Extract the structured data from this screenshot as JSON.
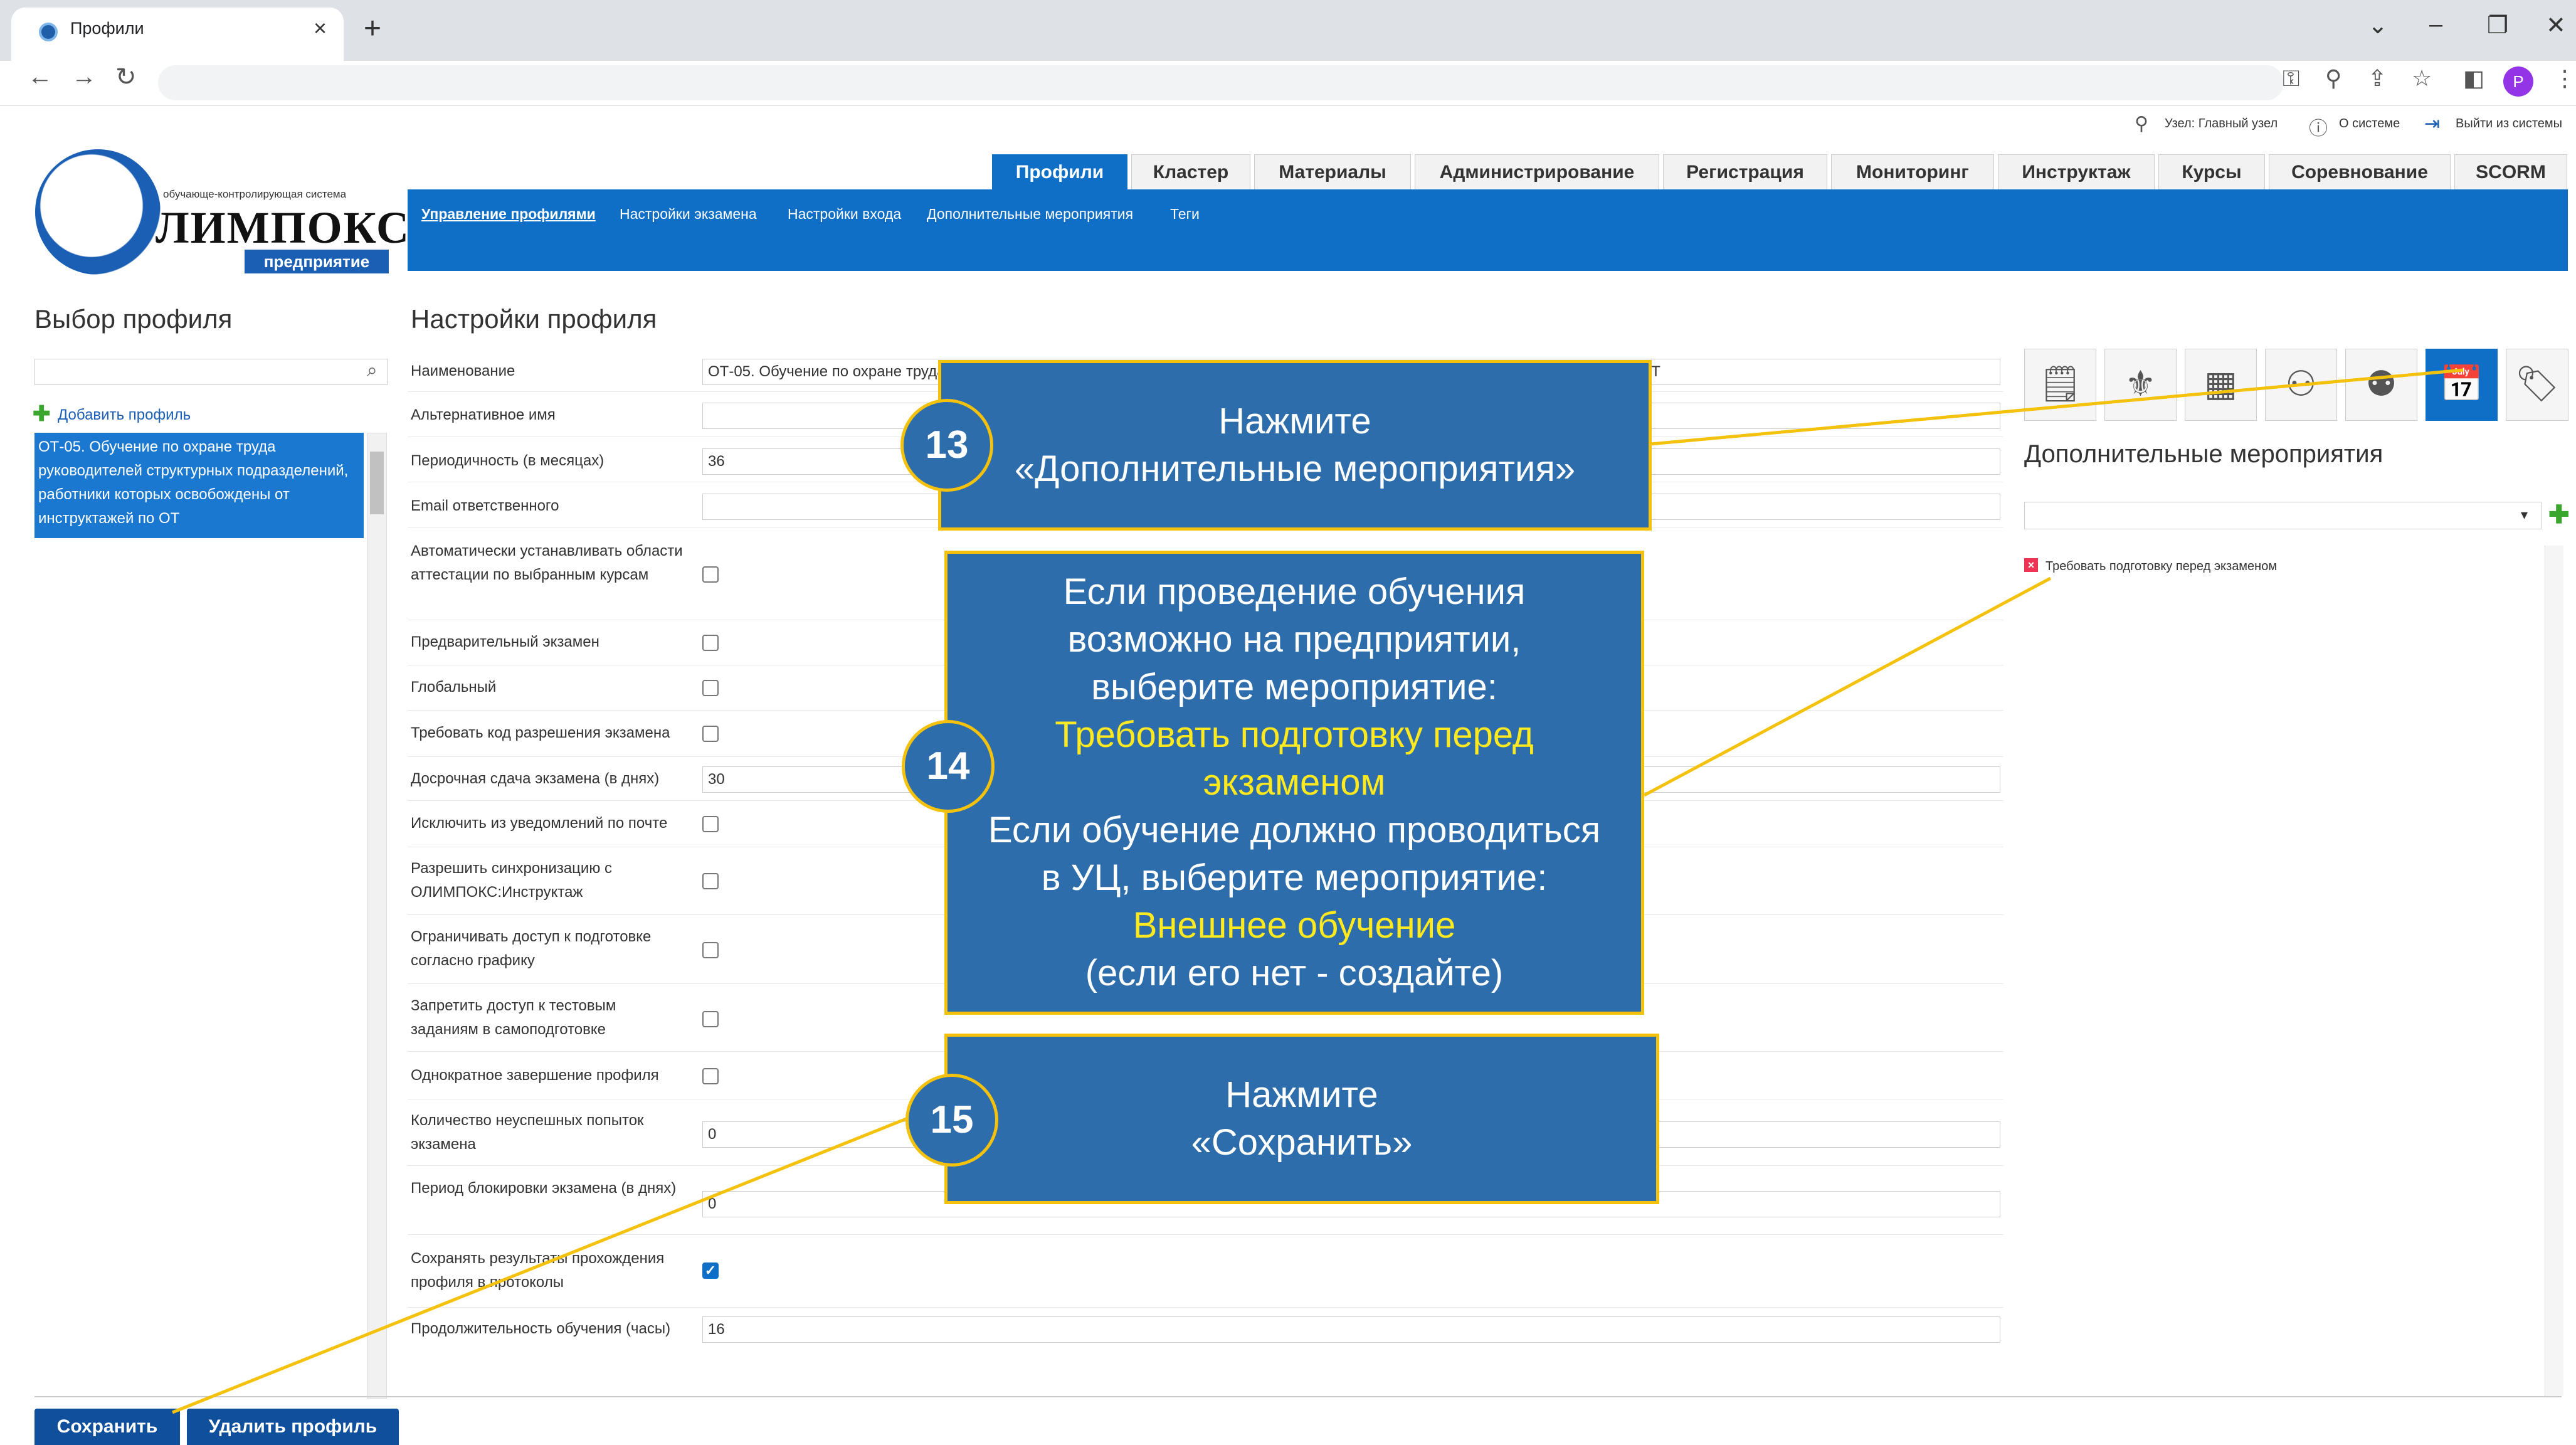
{
  "browser": {
    "tab_title": "Профили",
    "tab_close": "×",
    "new_tab": "+",
    "avatar_letter": "P"
  },
  "topbar": {
    "node": "Узел: Главный узел",
    "about": "О системе",
    "logout": "Выйти из системы"
  },
  "logo": {
    "tagline": "обучающе-контролирующая система",
    "brand": "ЛИМПОКС",
    "sub": "предприятие"
  },
  "nav": {
    "tabs": [
      "Профили",
      "Кластер",
      "Материалы",
      "Администрирование",
      "Регистрация",
      "Мониторинг",
      "Инструктаж",
      "Курсы",
      "Соревнование",
      "SCORM"
    ],
    "subtabs": [
      "Управление профилями",
      "Настройки экзамена",
      "Настройки входа",
      "Дополнительные мероприятия",
      "Теги"
    ]
  },
  "left": {
    "title": "Выбор профиля",
    "add_profile": "Добавить профиль",
    "selected_profile": "ОТ-05. Обучение по охране труда руководителей структурных подразделений, работники которых освобождены от инструктажей по ОТ"
  },
  "settings": {
    "title": "Настройки профиля",
    "name_label": "Наименование",
    "name_value": "ОТ-05. Обучение по охране труда руководителей структурных подразделений, работники которых освобождены от инструктажей по ОТ",
    "alt_name_label": "Альтернативное имя",
    "alt_name_value": "",
    "period_label": "Периодичность (в месяцах)",
    "period_value": "36",
    "email_label": "Email ответственного",
    "email_value": "",
    "auto_areas_label": "Автоматически устанавливать области аттестации по выбранным курсам",
    "pre_exam_label": "Предварительный экзамен",
    "global_label": "Глобальный",
    "require_code_label": "Требовать код разрешения экзамена",
    "early_exam_label": "Досрочная сдача экзамена (в днях)",
    "early_exam_value": "30",
    "exclude_notif_label": "Исключить из уведомлений по почте",
    "allow_sync_label": "Разрешить синхронизацию с ОЛИМПОКС:Инструктаж",
    "limit_access_label": "Ограничивать доступ к подготовке согласно графику",
    "deny_tests_label": "Запретить доступ к тестовым заданиям в самоподготовке",
    "single_complete_label": "Однократное завершение профиля",
    "failed_attempts_label": "Количество неуспешных попыток экзамена",
    "failed_attempts_value": "0",
    "block_period_label": "Период блокировки экзамена (в днях)",
    "block_period_value": "0",
    "save_results_label": "Сохранять результаты прохождения профиля в протоколы",
    "duration_label": "Продолжительность обучения (часы)",
    "duration_value": "16"
  },
  "right": {
    "events_title": "Дополнительные мероприятия",
    "event_item": "Требовать подготовку перед экзаменом",
    "icons": [
      "document-icon",
      "emblem-icon",
      "building-icon",
      "users-icon",
      "user-group-icon",
      "calendar-check-icon",
      "tag-icon"
    ]
  },
  "buttons": {
    "save": "Сохранить",
    "delete": "Удалить профиль"
  },
  "annotations": {
    "step13": {
      "num": "13",
      "l1": "Нажмите",
      "l2": "«Дополнительные мероприятия»"
    },
    "step14": {
      "num": "14",
      "l1": "Если проведение обучения",
      "l2": "возможно на предприятии,",
      "l3": "выберите мероприятие:",
      "l4": "Требовать подготовку перед",
      "l5": "экзаменом",
      "l6": "Если обучение должно проводиться",
      "l7": "в УЦ, выберите мероприятие:",
      "l8": "Внешнее обучение",
      "l9": "(если его нет - создайте)"
    },
    "step15": {
      "num": "15",
      "l1": "Нажмите",
      "l2": "«Сохранить»"
    }
  },
  "colors": {
    "brand_blue": "#0f6fc6",
    "callout_fill": "#2e6dab",
    "callout_border": "#f4c20d",
    "highlight_text": "#ffe91f"
  }
}
